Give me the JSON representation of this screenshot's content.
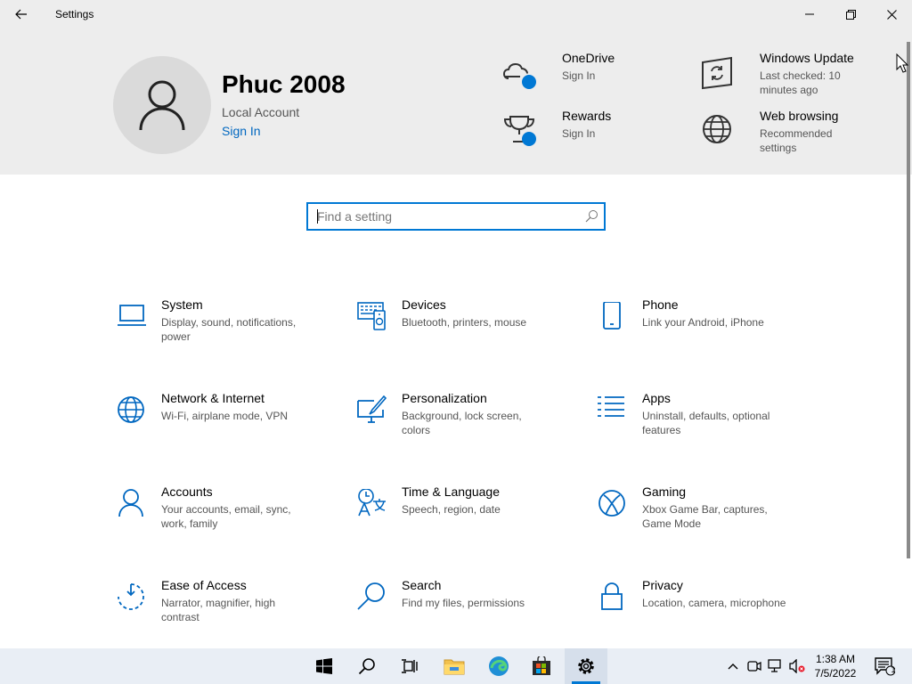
{
  "window": {
    "title": "Settings",
    "controls": [
      "back-arrow-icon",
      "minimize-icon",
      "maximize-icon",
      "close-icon"
    ]
  },
  "profile": {
    "name": "Phuc 2008",
    "account_type": "Local Account",
    "sign_in_label": "Sign In"
  },
  "services": [
    {
      "title": "OneDrive",
      "subtitle": "Sign In",
      "icon": "onedrive-cloud-icon"
    },
    {
      "title": "Windows Update",
      "subtitle": "Last checked: 10 minutes ago",
      "icon": "windows-update-icon"
    },
    {
      "title": "Rewards",
      "subtitle": "Sign In",
      "icon": "rewards-trophy-icon"
    },
    {
      "title": "Web browsing",
      "subtitle": "Recommended settings",
      "icon": "globe-icon"
    }
  ],
  "search": {
    "placeholder": "Find a setting"
  },
  "categories": [
    {
      "title": "System",
      "desc": "Display, sound, notifications, power",
      "icon": "laptop-icon"
    },
    {
      "title": "Devices",
      "desc": "Bluetooth, printers, mouse",
      "icon": "devices-icon"
    },
    {
      "title": "Phone",
      "desc": "Link your Android, iPhone",
      "icon": "phone-icon"
    },
    {
      "title": "Network & Internet",
      "desc": "Wi-Fi, airplane mode, VPN",
      "icon": "globe-network-icon"
    },
    {
      "title": "Personalization",
      "desc": "Background, lock screen, colors",
      "icon": "paint-brush-icon"
    },
    {
      "title": "Apps",
      "desc": "Uninstall, defaults, optional features",
      "icon": "apps-list-icon"
    },
    {
      "title": "Accounts",
      "desc": "Your accounts, email, sync, work, family",
      "icon": "person-icon"
    },
    {
      "title": "Time & Language",
      "desc": "Speech, region, date",
      "icon": "time-language-icon"
    },
    {
      "title": "Gaming",
      "desc": "Xbox Game Bar, captures, Game Mode",
      "icon": "xbox-icon"
    },
    {
      "title": "Ease of Access",
      "desc": "Narrator, magnifier, high contrast",
      "icon": "ease-of-access-icon"
    },
    {
      "title": "Search",
      "desc": "Find my files, permissions",
      "icon": "magnifier-icon"
    },
    {
      "title": "Privacy",
      "desc": "Location, camera, microphone",
      "icon": "lock-icon"
    }
  ],
  "taskbar": {
    "apps": [
      "start-windows-icon",
      "search-icon",
      "task-view-icon",
      "file-explorer-icon",
      "edge-browser-icon",
      "microsoft-store-icon",
      "settings-gear-icon"
    ],
    "active_app": "settings-gear-icon",
    "tray": [
      "chevron-up-icon",
      "meet-now-icon",
      "network-icon",
      "volume-muted-icon"
    ],
    "time": "1:38 AM",
    "date": "7/5/2022",
    "notification_count": "1"
  },
  "colors": {
    "accent": "#0078d4",
    "link": "#0067c0",
    "header_bg": "#ededed",
    "taskbar_bg": "#e9eef5"
  }
}
